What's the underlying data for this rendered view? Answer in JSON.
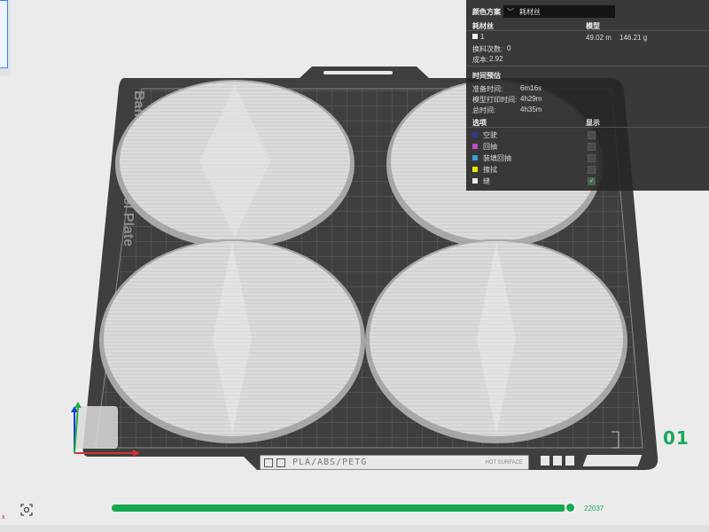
{
  "bed": {
    "id_label": "01",
    "plate_text": "Bambu Textured PEI Plate",
    "plate_text_visible": "Bamb",
    "plate_text_visible_2": "el Plate",
    "material_tag": "PLA/ABS/PETG",
    "surface_tag": "HOT SURFACE"
  },
  "panel": {
    "color_scheme_label": "颜色方案",
    "color_scheme_value": "耗材丝",
    "filament_header": "耗材丝",
    "model_header": "模型",
    "filament_index": "1",
    "filament_length": "49.02 m",
    "filament_weight": "146.21 g",
    "change_count_label": "换料次数:",
    "change_count_value": "0",
    "cost_label": "成本:",
    "cost_value": "2.92",
    "time_header": "时间预估",
    "prep_time_label": "准备时间:",
    "prep_time_value": "6m16s",
    "print_time_label": "模型打印时间:",
    "print_time_value": "4h29m",
    "total_time_label": "总时间:",
    "total_time_value": "4h35m",
    "options_header": "选项",
    "display_header": "显示",
    "options": [
      {
        "label": "空驶",
        "color": "#2d3b8f",
        "checked": false
      },
      {
        "label": "回抽",
        "color": "#b64fc8",
        "checked": false
      },
      {
        "label": "装填回抽",
        "color": "#3aa0d6",
        "checked": false
      },
      {
        "label": "擦拭",
        "color": "#e8e800",
        "checked": false
      },
      {
        "label": "缝",
        "color": "#ececec",
        "checked": true
      }
    ]
  },
  "progress": {
    "value": 22037,
    "fraction": 0.985,
    "label": "22037",
    "color": "#14a851"
  },
  "colors": {
    "bed": "#3f3f3f",
    "bed_grid": "#6a6a6a",
    "part": "#d9d9d9",
    "accent": "#14a851"
  }
}
